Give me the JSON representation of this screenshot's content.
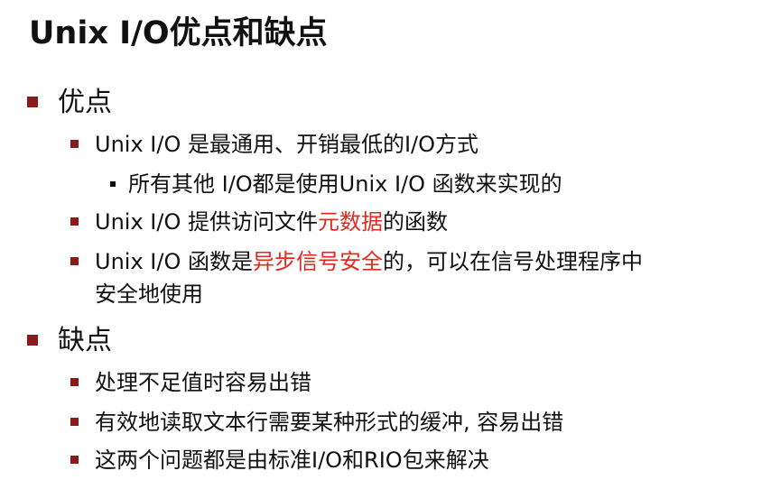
{
  "title": "Unix I/O优点和缺点",
  "colors": {
    "bullet_square": "#8b1a1a",
    "highlight": "#e32a1f",
    "text": "#111111"
  },
  "pros": {
    "heading": "优点",
    "items": [
      {
        "text": "Unix I/O 是最通用、开销最低的I/O方式",
        "sub": "所有其他 I/O都是使用Unix I/O 函数来实现的"
      },
      {
        "before": "Unix I/O 提供访问文件",
        "highlight": "元数据",
        "after": "的函数"
      },
      {
        "before": "Unix I/O 函数是",
        "highlight": "异步信号安全",
        "after": "的，可以在信号处理程序中",
        "continuation": "安全地使用"
      }
    ]
  },
  "cons": {
    "heading": "缺点",
    "items": [
      "处理不足值时容易出错",
      "有效地读取文本行需要某种形式的缓冲, 容易出错",
      "这两个问题都是由标准I/O和RIO包来解决"
    ]
  }
}
